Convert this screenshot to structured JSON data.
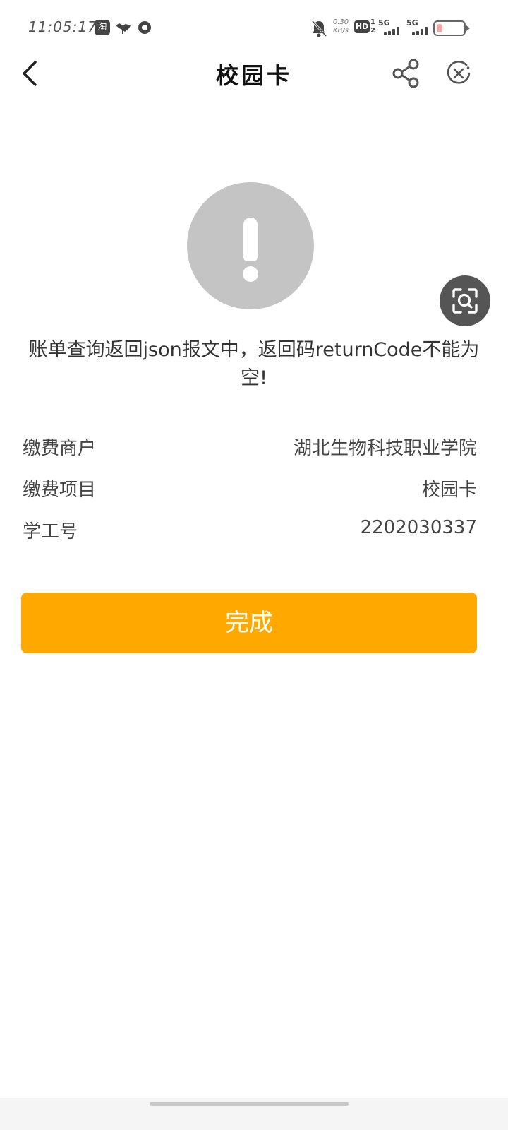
{
  "status_bar": {
    "time": "11:05:17",
    "taobao_badge": "淘",
    "net_speed_value": "0.30",
    "net_speed_unit": "KB/s",
    "hd_label": "HD",
    "hd_sim_top": "1",
    "hd_sim_bottom": "2",
    "signal_1_label": "5G",
    "signal_2_label": "5G",
    "battery_level": 0.2,
    "battery_color": "#f4a7a2"
  },
  "nav": {
    "title": "校园卡",
    "back_icon": "chevron-left-icon",
    "share_icon": "share-icon",
    "close_icon": "close-circle-icon"
  },
  "alert": {
    "icon": "exclamation-icon",
    "color": "#c4c4c4",
    "message": "账单查询返回json报文中，返回码returnCode不能为空!"
  },
  "scan_button": {
    "icon": "scan-search-icon",
    "color": "#555555"
  },
  "details": [
    {
      "label": "缴费商户",
      "value": "湖北生物科技职业学院"
    },
    {
      "label": "缴费项目",
      "value": "校园卡"
    },
    {
      "label": "学工号",
      "value": "2202030337"
    }
  ],
  "done_button": {
    "label": "完成",
    "color": "#ffa800"
  }
}
